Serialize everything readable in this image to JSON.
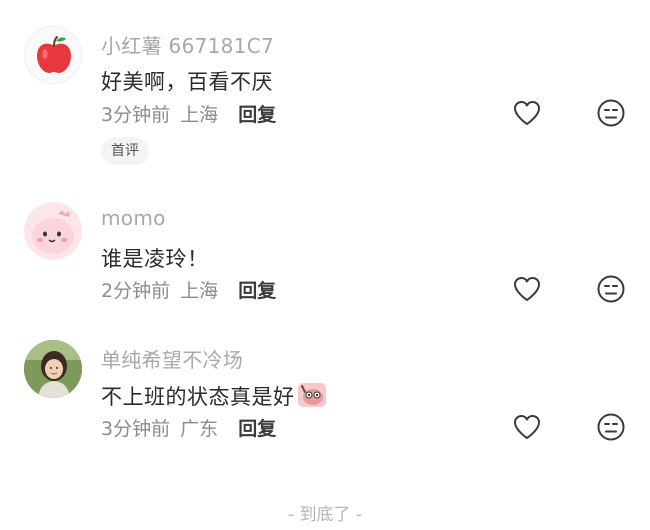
{
  "comments": [
    {
      "username": "小红薯 667181C7",
      "text": "好美啊，百看不厌",
      "time": "3分钟前",
      "location": "上海",
      "reply_label": "回复",
      "badge": "首评",
      "avatar_icon": "red-apple-icon"
    },
    {
      "username": "momo",
      "text": "谁是凌玲！",
      "time": "2分钟前",
      "location": "上海",
      "reply_label": "回复",
      "avatar_icon": "pink-cartoon-avatar"
    },
    {
      "username": "单纯希望不冷场",
      "text": "不上班的状态真是好",
      "time": "3分钟前",
      "location": "广东",
      "reply_label": "回复",
      "avatar_icon": "child-photo-avatar",
      "sticker_icon": "pink-cartoon-sticker-icon"
    }
  ],
  "footer": {
    "end_text": "- 到底了 -"
  },
  "icons": {
    "like": "heart-outline-icon",
    "dislike": "neutral-face-icon"
  },
  "colors": {
    "username": "#a8a8a8",
    "meta": "#8c8c8c",
    "apple": "#e8383d"
  }
}
